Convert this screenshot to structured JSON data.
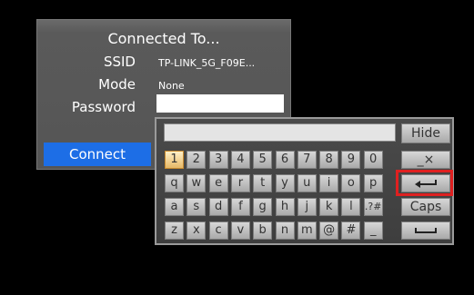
{
  "dialog": {
    "title": "Connected To...",
    "ssid_label": "SSID",
    "ssid_value": "TP-LINK_5G_F09E...",
    "mode_label": "Mode",
    "mode_value": "None",
    "password_label": "Password",
    "password_value": "",
    "connect_label": "Connect"
  },
  "keyboard": {
    "input_value": "",
    "hide_label": "Hide",
    "row1": [
      "1",
      "2",
      "3",
      "4",
      "5",
      "6",
      "7",
      "8",
      "9",
      "0"
    ],
    "row2": [
      "q",
      "w",
      "e",
      "r",
      "t",
      "y",
      "u",
      "i",
      "o",
      "p"
    ],
    "row3": [
      "a",
      "s",
      "d",
      "f",
      "g",
      "h",
      "j",
      "k",
      "l",
      ".?#"
    ],
    "row4": [
      "z",
      "x",
      "c",
      "v",
      "b",
      "n",
      "m",
      "@",
      "#",
      "_"
    ],
    "backspace_label": "_×",
    "caps_label": "Caps",
    "enter_icon": "enter-icon",
    "space_icon": "space-icon",
    "selected_key": "1",
    "highlight_color": "#e02020"
  }
}
